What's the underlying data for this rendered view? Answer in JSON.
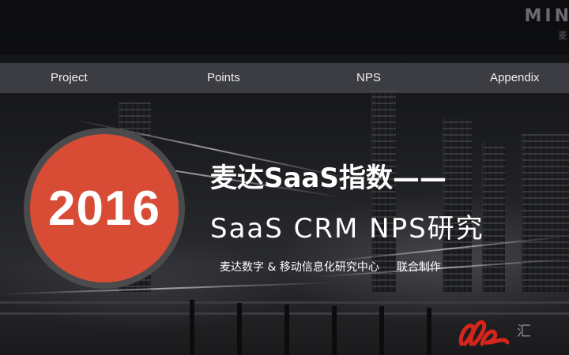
{
  "brand": {
    "mark": "MIN",
    "sub": "麦"
  },
  "nav": {
    "items": [
      {
        "label": "Project"
      },
      {
        "label": "Points"
      },
      {
        "label": "NPS"
      },
      {
        "label": "Appendix"
      }
    ]
  },
  "hero": {
    "year": "2016",
    "title_line1": "麦达SaaS指数——",
    "title_line2": "SaaS CRM NPS研究",
    "subtitle_org": "麦达数字 & 移动信息化研究中心",
    "subtitle_action": "联合制作"
  },
  "logo": {
    "icon": "brand-logo-icon",
    "text": "汇"
  },
  "colors": {
    "accent": "#d84c35",
    "ring": "#4b4b4d",
    "nav_bg": "#46484e",
    "logo_red": "#d8251c"
  }
}
